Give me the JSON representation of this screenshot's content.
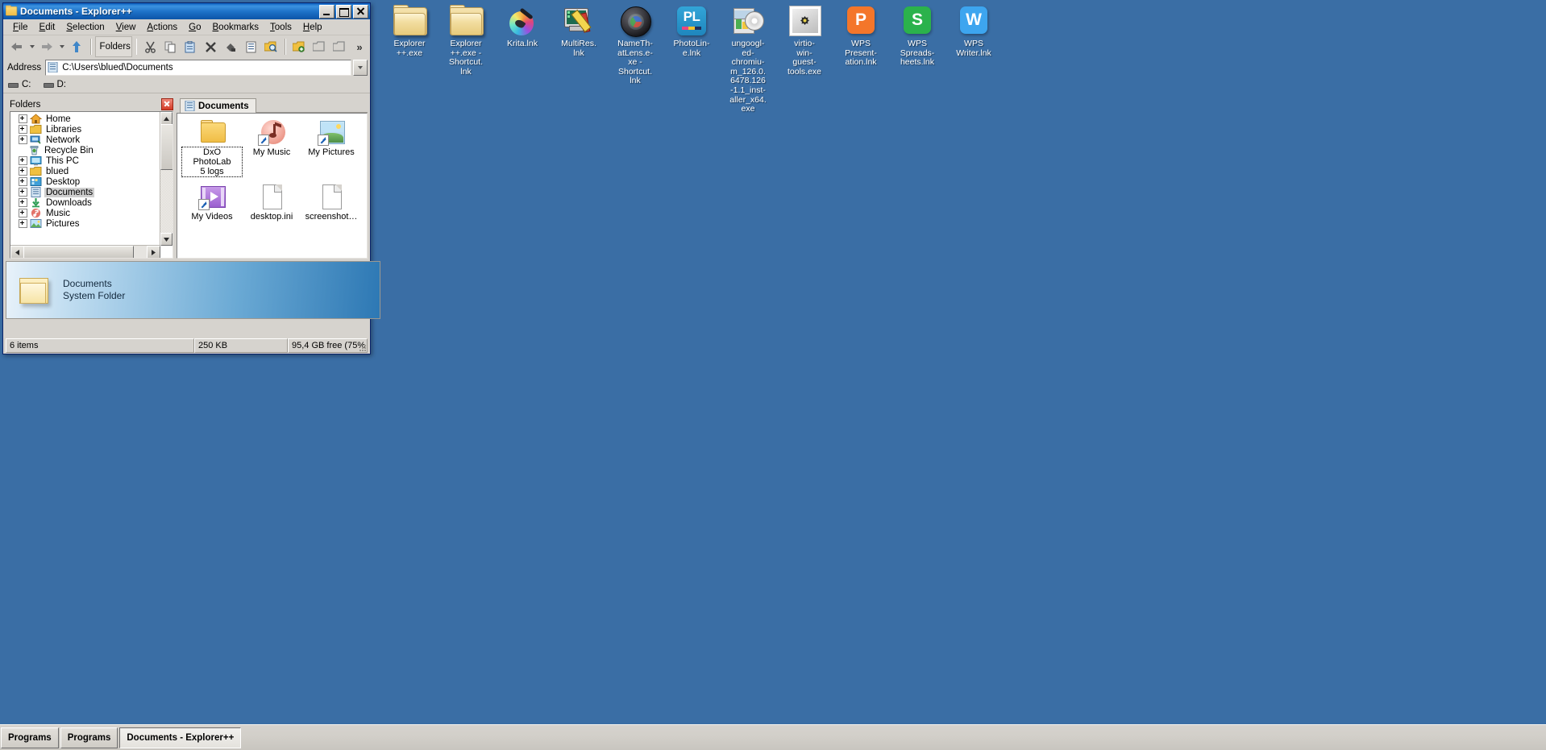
{
  "window": {
    "title": "Documents - Explorer++",
    "title_icon": "folder-icon",
    "buttons": {
      "minimize": "Minimize",
      "maximize": "Maximize",
      "close": "Close"
    },
    "menu": [
      "File",
      "Edit",
      "Selection",
      "View",
      "Actions",
      "Go",
      "Bookmarks",
      "Tools",
      "Help"
    ],
    "toolbar": {
      "back": "Back",
      "forward": "Forward",
      "up": "Up",
      "folders_label": "Folders",
      "cut": "Cut",
      "copy": "Copy",
      "paste": "Paste",
      "delete": "Delete",
      "properties": "Properties",
      "views": "Views",
      "search": "Search",
      "new_folder": "New Folder",
      "copy_to": "Copy To",
      "move_to": "Move To",
      "overflow": "»"
    },
    "address": {
      "label": "Address",
      "value": "C:\\Users\\blued\\Documents",
      "icon": "documents-icon",
      "dropdown": "▼"
    },
    "drives": [
      {
        "label": "C:",
        "icon": "drive-icon"
      },
      {
        "label": "D:",
        "icon": "drive-icon"
      }
    ]
  },
  "folders_pane": {
    "header": "Folders",
    "close": "Close folders pane",
    "tree": [
      {
        "label": "Home",
        "icon": "home-icon",
        "expandable": true,
        "selected": false,
        "indent": 0
      },
      {
        "label": "Libraries",
        "icon": "libraries-icon",
        "expandable": true,
        "selected": false,
        "indent": 0
      },
      {
        "label": "Network",
        "icon": "network-icon",
        "expandable": true,
        "selected": false,
        "indent": 0
      },
      {
        "label": "Recycle Bin",
        "icon": "recyclebin-icon",
        "expandable": false,
        "selected": false,
        "indent": 0
      },
      {
        "label": "This PC",
        "icon": "thispc-icon",
        "expandable": true,
        "selected": false,
        "indent": 0
      },
      {
        "label": "blued",
        "icon": "userfolder-icon",
        "expandable": true,
        "selected": false,
        "indent": 0
      },
      {
        "label": "Desktop",
        "icon": "desktop-icon",
        "expandable": true,
        "selected": false,
        "indent": 0
      },
      {
        "label": "Documents",
        "icon": "documents-icon",
        "expandable": true,
        "selected": true,
        "indent": 0
      },
      {
        "label": "Downloads",
        "icon": "downloads-icon",
        "expandable": true,
        "selected": false,
        "indent": 0
      },
      {
        "label": "Music",
        "icon": "music-icon",
        "expandable": true,
        "selected": false,
        "indent": 0
      },
      {
        "label": "Pictures",
        "icon": "pictures-icon",
        "expandable": true,
        "selected": false,
        "indent": 0
      }
    ]
  },
  "files_pane": {
    "tab": {
      "label": "Documents",
      "icon": "documents-icon"
    },
    "items": [
      {
        "name": "DxO PhotoLab\n5 logs",
        "icon": "folder-icon",
        "shortcut": false,
        "focused": true
      },
      {
        "name": "My Music",
        "icon": "music-icon",
        "shortcut": true,
        "focused": false
      },
      {
        "name": "My Pictures",
        "icon": "pictures-icon",
        "shortcut": true,
        "focused": false
      },
      {
        "name": "My Videos",
        "icon": "videos-icon",
        "shortcut": true,
        "focused": false
      },
      {
        "name": "desktop.ini",
        "icon": "file-icon",
        "shortcut": false,
        "focused": false
      },
      {
        "name": "screenshot…",
        "icon": "file-icon",
        "shortcut": false,
        "focused": false
      }
    ]
  },
  "info_band": {
    "title": "Documents",
    "subtitle": "System Folder",
    "icon": "folder-icon"
  },
  "status_bar": {
    "items_count": "6 items",
    "size": "250 KB",
    "free_space": "95,4 GB free (75%"
  },
  "desktop": {
    "icons": [
      {
        "label": "Explorer\n++.exe",
        "icon": "folder-icon",
        "kind": "folder"
      },
      {
        "label": "Explorer\n++.exe -\nShortcut.\nlnk",
        "icon": "folder-icon",
        "kind": "folder"
      },
      {
        "label": "Krita.lnk",
        "icon": "krita-icon",
        "kind": "krita"
      },
      {
        "label": "MultiRes.\nlnk",
        "icon": "multires-icon",
        "kind": "multires"
      },
      {
        "label": "NameTh-\natLens.e-\nxe -\nShortcut.\nlnk",
        "icon": "namethatlens-icon",
        "kind": "lens"
      },
      {
        "label": "PhotoLin-\ne.lnk",
        "icon": "photoline-icon",
        "kind": "photoline"
      },
      {
        "label": "ungoogl-\ned-\nchromiu-\nm_126.0.\n6478.126\n-1.1_inst-\naller_x64.\nexe",
        "icon": "chromium-installer-icon",
        "kind": "installer"
      },
      {
        "label": "virtio-\nwin-\nguest-\ntools.exe",
        "icon": "virtio-icon",
        "kind": "virtio"
      },
      {
        "label": "WPS\nPresent-\nation.lnk",
        "icon": "wps-presentation-icon",
        "kind": "wps",
        "glyph": "P",
        "color": "#f4762a"
      },
      {
        "label": "WPS\nSpreads-\nheets.lnk",
        "icon": "wps-spreadsheets-icon",
        "kind": "wps",
        "glyph": "S",
        "color": "#2bb24c"
      },
      {
        "label": "WPS\nWriter.lnk",
        "icon": "wps-writer-icon",
        "kind": "wps",
        "glyph": "W",
        "color": "#3da5ef"
      }
    ]
  },
  "taskbar": {
    "buttons": [
      {
        "label": "Programs",
        "active": false
      },
      {
        "label": "Programs",
        "active": false
      },
      {
        "label": "Documents - Explorer++",
        "active": true
      }
    ]
  },
  "colors": {
    "desktop_bg": "#3a6ea5",
    "window_face": "#d6d3ce",
    "title_active": "#1e72c8",
    "selection": "#cfcfcf"
  }
}
